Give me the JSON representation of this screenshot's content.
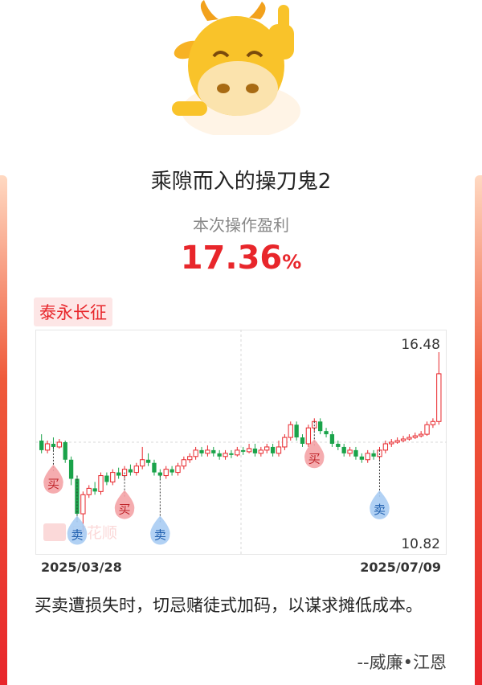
{
  "header": {
    "title": "乘隙而入的操刀鬼2"
  },
  "result": {
    "label": "本次操作盈利",
    "profit_value": "17.36",
    "profit_unit": "%"
  },
  "stock": {
    "name": "泰永长征"
  },
  "chart": {
    "y_max_label": "16.48",
    "y_min_label": "10.82",
    "start_date": "2025/03/28",
    "end_date": "2025/07/09",
    "watermark": "同花顺",
    "buy_label": "买",
    "sell_label": "卖"
  },
  "quote": {
    "text": "买卖遭损失时，切忌赌徒式加码，以谋求摊低成本。",
    "author": "--威廉•江恩"
  },
  "colors": {
    "accent": "#e8262b",
    "up": "#e8262b",
    "down": "#1aa34a",
    "buy_marker": "#f4a3a6",
    "sell_marker": "#a9ccf3"
  },
  "chart_data": {
    "type": "candlestick",
    "x_range": [
      "2025/03/28",
      "2025/07/09"
    ],
    "y_range": [
      10.82,
      16.48
    ],
    "candles": [
      [
        13.7,
        13.4,
        13.9,
        13.3
      ],
      [
        13.4,
        13.6,
        13.7,
        13.3
      ],
      [
        13.6,
        13.5,
        13.8,
        13.4
      ],
      [
        13.5,
        13.65,
        13.75,
        13.45
      ],
      [
        13.65,
        13.1,
        13.7,
        13.0
      ],
      [
        13.1,
        12.5,
        13.2,
        12.3
      ],
      [
        12.5,
        11.4,
        12.6,
        11.2
      ],
      [
        11.4,
        12.0,
        12.1,
        10.82
      ],
      [
        12.0,
        12.2,
        12.3,
        11.9
      ],
      [
        12.2,
        12.1,
        12.4,
        12.0
      ],
      [
        12.1,
        12.6,
        12.7,
        12.0
      ],
      [
        12.6,
        12.4,
        12.7,
        12.3
      ],
      [
        12.4,
        12.7,
        12.8,
        12.3
      ],
      [
        12.7,
        12.6,
        12.85,
        12.5
      ],
      [
        12.6,
        12.8,
        12.9,
        12.5
      ],
      [
        12.8,
        12.7,
        12.95,
        12.6
      ],
      [
        12.7,
        12.9,
        13.0,
        12.6
      ],
      [
        12.9,
        13.1,
        13.5,
        12.8
      ],
      [
        13.1,
        13.0,
        13.3,
        12.9
      ],
      [
        13.0,
        12.7,
        13.1,
        12.6
      ],
      [
        12.7,
        12.6,
        12.8,
        12.5
      ],
      [
        12.6,
        12.8,
        12.9,
        12.5
      ],
      [
        12.8,
        12.7,
        12.9,
        12.6
      ],
      [
        12.7,
        12.9,
        13.0,
        12.6
      ],
      [
        12.9,
        13.1,
        13.2,
        12.8
      ],
      [
        13.1,
        13.2,
        13.3,
        13.0
      ],
      [
        13.2,
        13.4,
        13.5,
        13.1
      ],
      [
        13.4,
        13.3,
        13.5,
        13.2
      ],
      [
        13.3,
        13.4,
        13.55,
        13.2
      ],
      [
        13.4,
        13.3,
        13.5,
        13.2
      ],
      [
        13.3,
        13.2,
        13.4,
        13.1
      ],
      [
        13.2,
        13.3,
        13.4,
        13.1
      ],
      [
        13.3,
        13.25,
        13.4,
        13.15
      ],
      [
        13.25,
        13.4,
        13.5,
        13.2
      ],
      [
        13.4,
        13.35,
        13.5,
        13.25
      ],
      [
        13.35,
        13.45,
        13.6,
        13.3
      ],
      [
        13.45,
        13.3,
        13.6,
        13.2
      ],
      [
        13.3,
        13.4,
        13.5,
        13.2
      ],
      [
        13.4,
        13.5,
        13.6,
        13.3
      ],
      [
        13.5,
        13.3,
        13.6,
        13.2
      ],
      [
        13.3,
        13.5,
        13.7,
        13.2
      ],
      [
        13.5,
        13.8,
        13.9,
        13.4
      ],
      [
        13.8,
        14.2,
        14.3,
        13.7
      ],
      [
        14.2,
        13.8,
        14.3,
        13.7
      ],
      [
        13.8,
        13.6,
        13.9,
        13.5
      ],
      [
        13.6,
        14.1,
        14.2,
        13.5
      ],
      [
        14.1,
        14.3,
        14.4,
        14.0
      ],
      [
        14.3,
        14.0,
        14.4,
        13.9
      ],
      [
        14.0,
        13.9,
        14.1,
        13.8
      ],
      [
        13.9,
        13.6,
        14.0,
        13.5
      ],
      [
        13.6,
        13.5,
        13.7,
        13.4
      ],
      [
        13.5,
        13.3,
        13.6,
        13.2
      ],
      [
        13.3,
        13.4,
        13.5,
        13.2
      ],
      [
        13.4,
        13.2,
        13.5,
        13.1
      ],
      [
        13.2,
        13.1,
        13.3,
        13.0
      ],
      [
        13.1,
        13.3,
        13.4,
        13.0
      ],
      [
        13.3,
        13.2,
        13.4,
        13.1
      ],
      [
        13.2,
        13.4,
        13.5,
        13.1
      ],
      [
        13.4,
        13.6,
        13.7,
        13.3
      ],
      [
        13.6,
        13.65,
        13.75,
        13.5
      ],
      [
        13.65,
        13.7,
        13.8,
        13.6
      ],
      [
        13.7,
        13.75,
        13.85,
        13.65
      ],
      [
        13.75,
        13.8,
        13.9,
        13.7
      ],
      [
        13.8,
        13.85,
        13.95,
        13.75
      ],
      [
        13.85,
        13.9,
        14.0,
        13.8
      ],
      [
        13.9,
        14.2,
        14.3,
        13.85
      ],
      [
        14.2,
        14.3,
        14.4,
        14.1
      ],
      [
        14.3,
        15.8,
        16.48,
        14.2
      ]
    ],
    "trades": [
      {
        "type": "buy",
        "day": 2,
        "price": 13.5
      },
      {
        "type": "sell",
        "day": 6,
        "price": 12.6
      },
      {
        "type": "buy",
        "day": 14,
        "price": 12.7
      },
      {
        "type": "sell",
        "day": 20,
        "price": 12.6
      },
      {
        "type": "buy",
        "day": 46,
        "price": 14.3
      },
      {
        "type": "sell",
        "day": 57,
        "price": 13.4
      }
    ]
  }
}
